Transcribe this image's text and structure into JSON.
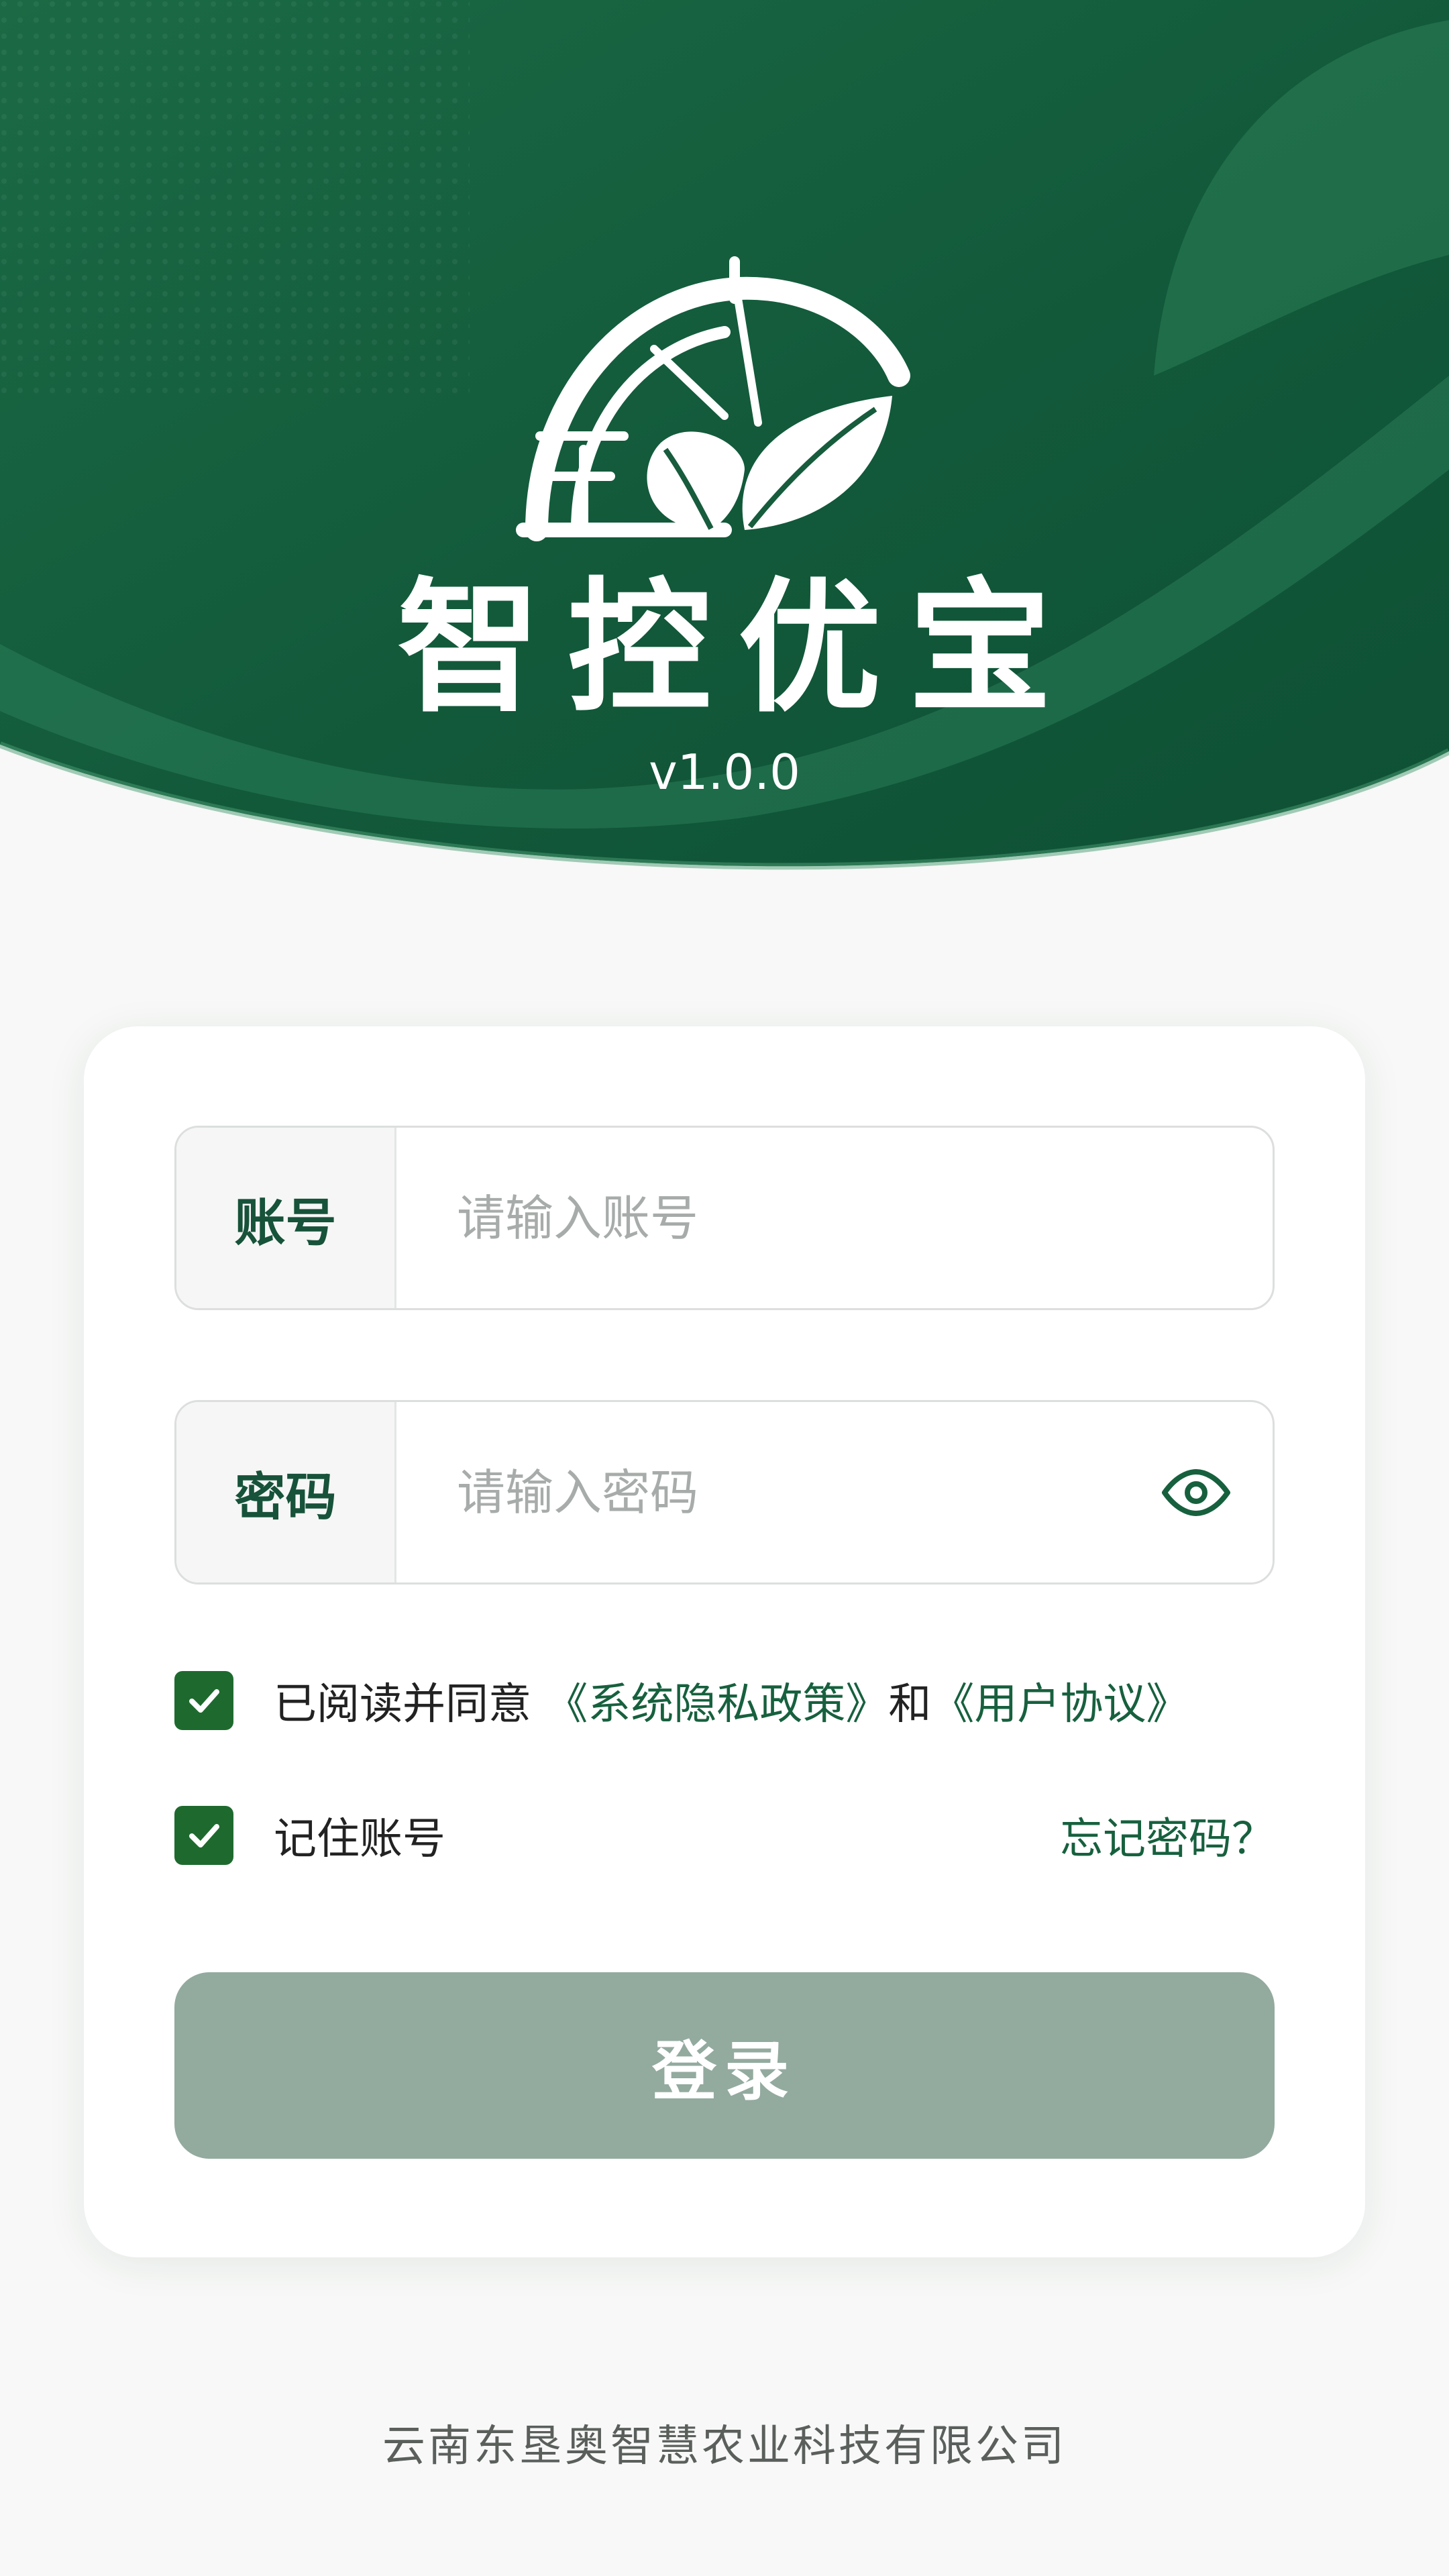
{
  "app": {
    "title": "智控优宝",
    "version": "v1.0.0"
  },
  "form": {
    "account": {
      "label": "账号",
      "placeholder": "请输入账号",
      "value": ""
    },
    "password": {
      "label": "密码",
      "placeholder": "请输入密码",
      "value": ""
    },
    "agreement": {
      "checked": true,
      "prefix": "已阅读并同意",
      "privacy_link": "《系统隐私政策》",
      "conjunction": "和",
      "user_link": "《用户协议》"
    },
    "remember": {
      "checked": true,
      "label": "记住账号"
    },
    "forgot_label": "忘记密码？",
    "login_label": "登录"
  },
  "footer": {
    "company": "云南东垦奥智慧农业科技有限公司"
  },
  "colors": {
    "brand_dark": "#0f5a3c",
    "brand_mid": "#1d6e49",
    "checkbox": "#1e6a2e",
    "login_button": "#93aa9f",
    "link": "#17603e"
  },
  "icons": {
    "logo": "greenhouse-leaf-logo",
    "password_toggle": "eye-icon",
    "checkbox": "check-icon"
  }
}
